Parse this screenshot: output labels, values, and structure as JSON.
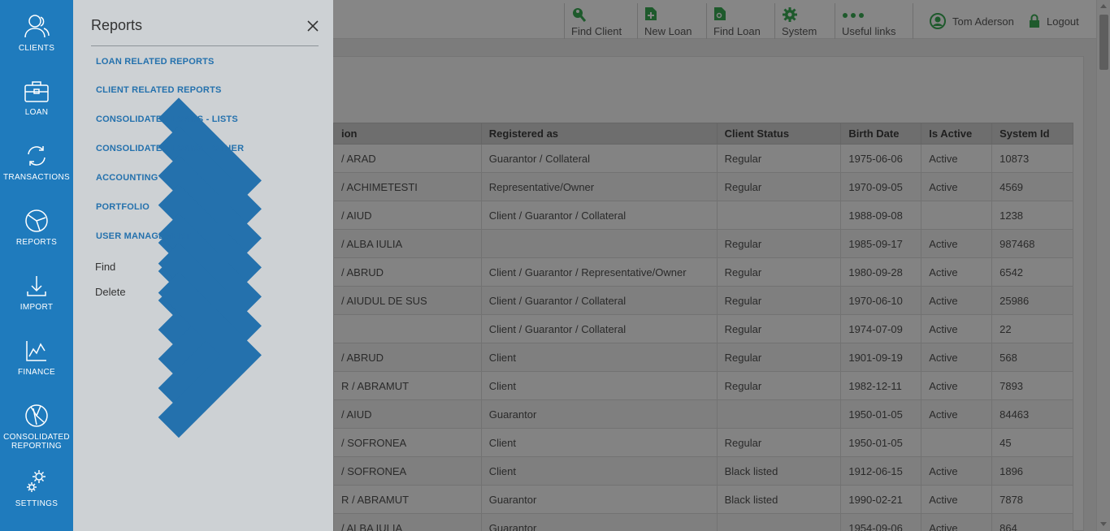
{
  "sidebar": {
    "items": [
      {
        "label": "CLIENTS",
        "icon": "users-icon"
      },
      {
        "label": "LOAN",
        "icon": "briefcase-icon"
      },
      {
        "label": "TRANSACTIONS",
        "icon": "refresh-icon"
      },
      {
        "label": "REPORTS",
        "icon": "pie-chart-icon"
      },
      {
        "label": "IMPORT",
        "icon": "download-icon"
      },
      {
        "label": "FINANCE",
        "icon": "line-chart-icon"
      },
      {
        "label": "CONSOLIDATED REPORTING",
        "icon": "pie-slices-icon"
      },
      {
        "label": "SETTINGS",
        "icon": "gears-icon"
      }
    ]
  },
  "topbar": {
    "find_client": "Find Client",
    "new_loan": "New Loan",
    "find_loan": "Find Loan",
    "system": "System",
    "useful_links": "Useful links",
    "user_name": "Tom Aderson",
    "logout": "Logout"
  },
  "flyout": {
    "title": "Reports",
    "menu": [
      "LOAN RELATED REPORTS",
      "CLIENT RELATED REPORTS",
      "CONSOLIDATED LOANS - LISTS",
      "CONSOLIDATED LOANS - OTHER",
      "ACCOUNTING",
      "PORTFOLIO",
      "USER MANAGEMENT"
    ],
    "find": "Find",
    "delete": "Delete"
  },
  "grid": {
    "columns": [
      "ion",
      "Registered as",
      "Client Status",
      "Birth Date",
      "Is Active",
      "System Id"
    ],
    "rows": [
      [
        "/ ARAD",
        "Guarantor / Collateral",
        "Regular",
        "1975-06-06",
        "Active",
        "10873"
      ],
      [
        "/ ACHIMETESTI",
        "Representative/Owner",
        "Regular",
        "1970-09-05",
        "Active",
        "4569"
      ],
      [
        "/ AIUD",
        "Client / Guarantor / Collateral",
        "",
        "1988-09-08",
        "",
        "1238"
      ],
      [
        "/ ALBA IULIA",
        "",
        "Regular",
        "1985-09-17",
        "Active",
        "987468"
      ],
      [
        "/ ABRUD",
        "Client / Guarantor / Representative/Owner",
        "Regular",
        "1980-09-28",
        "Active",
        "6542"
      ],
      [
        "/ AIUDUL DE SUS",
        "Client / Guarantor / Collateral",
        "Regular",
        "1970-06-10",
        "Active",
        "25986"
      ],
      [
        "",
        "Client / Guarantor / Collateral",
        "Regular",
        "1974-07-09",
        "Active",
        "22"
      ],
      [
        "/ ABRUD",
        "Client",
        "Regular",
        "1901-09-19",
        "Active",
        "568"
      ],
      [
        "R / ABRAMUT",
        "Client",
        "Regular",
        "1982-12-11",
        "Active",
        "7893"
      ],
      [
        "/ AIUD",
        "Guarantor",
        "",
        "1950-01-05",
        "Active",
        "84463"
      ],
      [
        "/ SOFRONEA",
        "Client",
        "Regular",
        "1950-01-05",
        "",
        "45"
      ],
      [
        "/ SOFRONEA",
        "Client",
        "Black listed",
        "1912-06-15",
        "Active",
        "1896"
      ],
      [
        "R / ABRAMUT",
        "Guarantor",
        "Black listed",
        "1990-02-21",
        "Active",
        "7878"
      ],
      [
        "/ ALBA IULIA",
        "Guarantor",
        "",
        "1954-09-06",
        "Active",
        "864"
      ]
    ]
  },
  "colors": {
    "sidebar_bg": "#1f7bbd",
    "flyout_bg": "#cdd1d4",
    "menu_link": "#2471ad",
    "topbar_icon_green": "#1e5a2c"
  }
}
